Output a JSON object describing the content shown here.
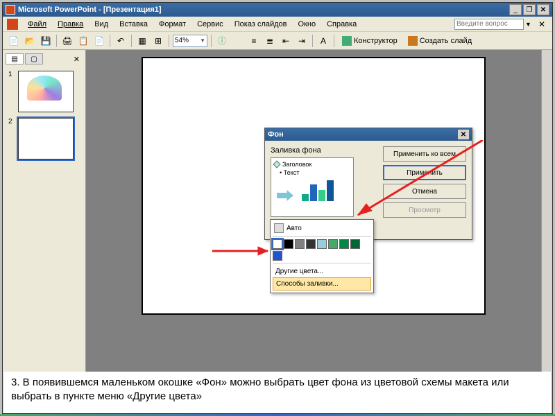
{
  "title_bar": {
    "text": "Microsoft PowerPoint - [Презентация1]"
  },
  "menu": {
    "file": "Файл",
    "edit": "Правка",
    "view": "Вид",
    "insert": "Вставка",
    "format": "Формат",
    "tools": "Сервис",
    "slideshow": "Показ слайдов",
    "window": "Окно",
    "help": "Справка"
  },
  "help_placeholder": "Введите вопрос",
  "toolbar": {
    "zoom": "54%",
    "designer": "Конструктор",
    "new_slide": "Создать слайд"
  },
  "slides": {
    "n1": "1",
    "n2": "2"
  },
  "dialog": {
    "title": "Фон",
    "group": "Заливка фона",
    "preview_title": "Заголовок",
    "preview_text": "Текст",
    "apply_all": "Применить ко всем",
    "apply": "Применить",
    "cancel": "Отмена",
    "preview_btn": "Просмотр"
  },
  "popup": {
    "auto": "Авто",
    "more_colors": "Другие цвета...",
    "fill_effects": "Способы заливки...",
    "colors": [
      "#ffffff",
      "#000000",
      "#808080",
      "#333333",
      "#99ccdd",
      "#44aa66",
      "#008844",
      "#006633"
    ],
    "recent": [
      "#2255cc"
    ]
  },
  "caption": {
    "text": "3.   В появившемся маленьком окошке «Фон» можно выбрать цвет фона из цветовой схемы макета или выбрать в пункте меню «Другие цвета»"
  }
}
